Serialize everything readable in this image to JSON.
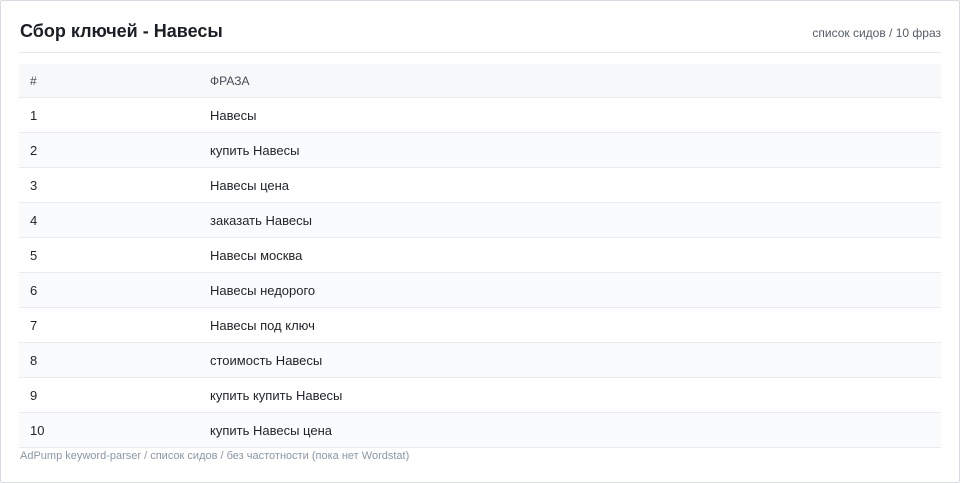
{
  "header": {
    "title": "Сбор ключей - Навесы",
    "meta": "список сидов / 10 фраз"
  },
  "table": {
    "columns": [
      "#",
      "ФРАЗА"
    ],
    "rows": [
      {
        "num": "1",
        "phrase": "Навесы"
      },
      {
        "num": "2",
        "phrase": "купить Навесы"
      },
      {
        "num": "3",
        "phrase": "Навесы цена"
      },
      {
        "num": "4",
        "phrase": "заказать Навесы"
      },
      {
        "num": "5",
        "phrase": "Навесы москва"
      },
      {
        "num": "6",
        "phrase": "Навесы недорого"
      },
      {
        "num": "7",
        "phrase": "Навесы под ключ"
      },
      {
        "num": "8",
        "phrase": "стоимость Навесы"
      },
      {
        "num": "9",
        "phrase": "купить купить Навесы"
      },
      {
        "num": "10",
        "phrase": "купить Навесы цена"
      }
    ]
  },
  "footer": {
    "text": "AdPump keyword-parser / список сидов / без частотности (пока нет Wordstat)"
  }
}
